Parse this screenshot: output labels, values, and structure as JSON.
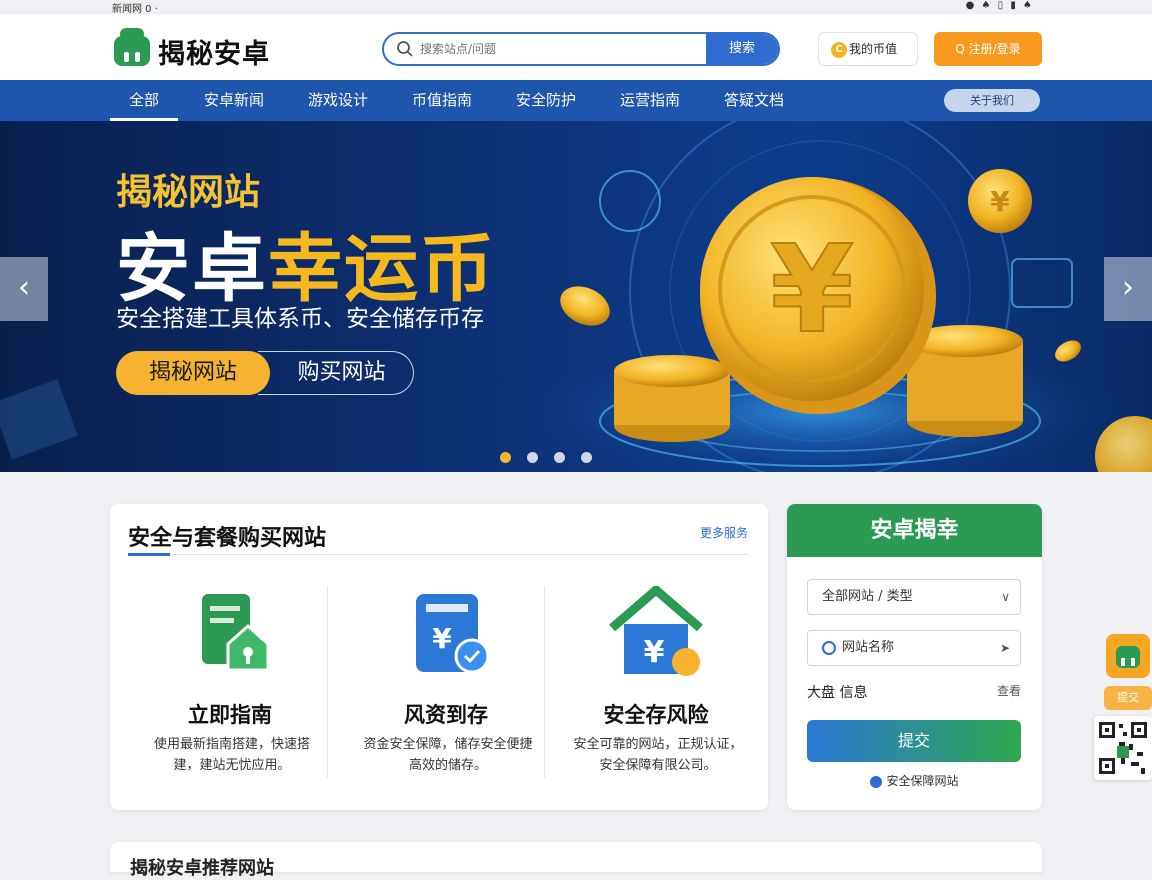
{
  "status_bar": {
    "left": "新闻网 0 ·",
    "right": "● ♠ ▯ ▮ ♠"
  },
  "header": {
    "logo_text": "揭秘安卓",
    "search_placeholder": "搜索站点/问题",
    "search_button": "搜索",
    "coin_button": "我的币值",
    "coin_glyph": "C",
    "login_button": "Q 注册/登录"
  },
  "nav": {
    "items": [
      "全部",
      "安卓新闻",
      "游戏设计",
      "币值指南",
      "安全防护",
      "运营指南",
      "答疑文档"
    ],
    "pill": "关于我们"
  },
  "hero": {
    "subtitle": "揭秘网站",
    "title_white": "安卓",
    "title_yellow": "幸运币",
    "description": "安全搭建工具体系币、安全储存币存",
    "btn_primary": "揭秘网站",
    "btn_secondary": "购买网站",
    "prev_glyph": "‹",
    "next_glyph": "›",
    "slide_count": 4,
    "active_slide": 0
  },
  "main_card": {
    "title": "安全与套餐购买网站",
    "more": "更多服务",
    "features": [
      {
        "title": "立即指南",
        "desc": "使用最新指南搭建，快速搭建，建站无忧应用。",
        "icon": "document-house-icon"
      },
      {
        "title": "风资到存",
        "desc": "资金安全保障，储存安全便捷高效的储存。",
        "icon": "wallet-check-icon"
      },
      {
        "title": "安全存风险",
        "desc": "安全可靠的网站，正规认证，安全保障有限公司。",
        "icon": "house-coin-icon"
      }
    ]
  },
  "side_card": {
    "title": "安卓揭幸",
    "select1": "全部网站 / 类型",
    "select2": "网站名称",
    "row_label": "大盘 信息",
    "row_value": "查看",
    "button": "提交",
    "note": "安全保障网站"
  },
  "float": {
    "button": "提交"
  },
  "bottom_card": {
    "title": "揭秘安卓推荐网站"
  },
  "colors": {
    "primary_blue": "#1e55ad",
    "accent_orange": "#f79a1e",
    "green": "#2c9a52",
    "gold": "#f5b81f"
  }
}
